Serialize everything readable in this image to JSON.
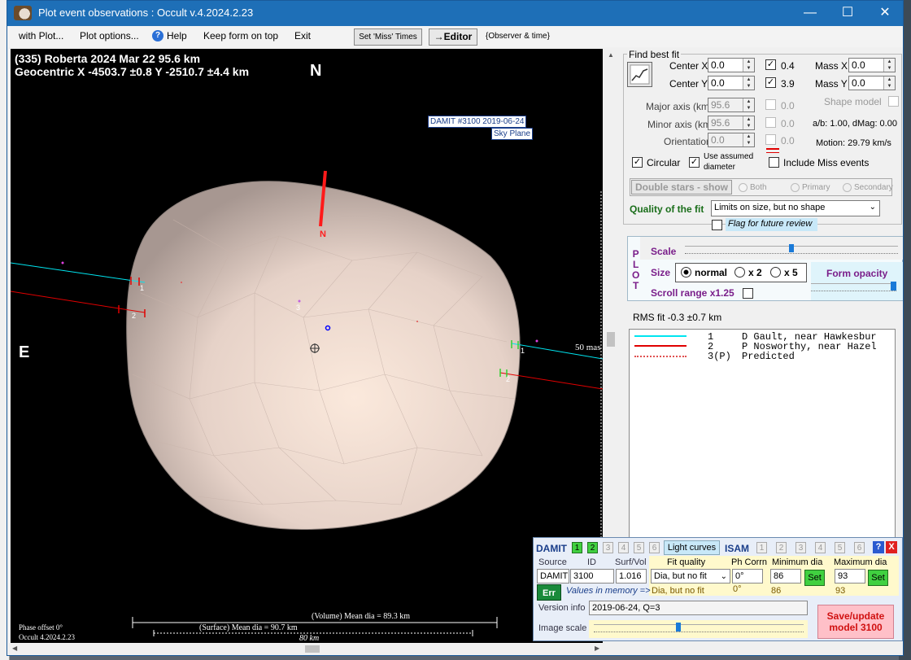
{
  "window": {
    "title": "Plot event observations : Occult v.4.2024.2.23",
    "minimize": "—",
    "maximize": "☐",
    "close": "✕"
  },
  "menu": {
    "with_plot": "with Plot...",
    "plot_options": "Plot options...",
    "help": "Help",
    "keep_on_top": "Keep form on top",
    "exit": "Exit",
    "set_miss": "Set 'Miss' Times",
    "editor": "→Editor",
    "observer_time": "{Observer & time}"
  },
  "plot": {
    "line1": "(335) Roberta  2024 Mar 22   95.6 km",
    "line2": "Geocentric  X  -4503.7 ±0.8  Y -2510.7 ±4.4 km",
    "north": "N",
    "east": "E",
    "north_marker": "N",
    "damit_label": "DAMIT #3100 2019-06-24",
    "sky_plane": "Sky Plane",
    "scale_mas": "50 mas",
    "chord_labels": [
      "1",
      "2",
      "1",
      "2",
      "3"
    ],
    "phase_offset": "Phase offset 0°",
    "version": "Occult 4.2024.2.23",
    "volume_dia": "(Volume) Mean dia = 89.3 km",
    "surface_dia": "(Surface) Mean dia = 90.7 km",
    "km_scale": "80 km"
  },
  "fit": {
    "title": "Find best fit",
    "center_x_label": "Center X",
    "center_x": "0.0",
    "center_y_label": "Center Y",
    "center_y": "0.0",
    "cb_04": "0.4",
    "cb_39": "3.9",
    "mass_x_label": "Mass X",
    "mass_x": "0.0",
    "mass_y_label": "Mass Y",
    "mass_y": "0.0",
    "major_label": "Major axis (km)",
    "major": "95.6",
    "major_cb": "0.0",
    "minor_label": "Minor axis (km)",
    "minor": "95.6",
    "minor_cb": "0.0",
    "orient_label": "Orientation",
    "orient": "0.0",
    "orient_cb": "0.0",
    "shape_model": "Shape model",
    "ab": "a/b: 1.00, dMag: 0.00",
    "motion": "Motion: 29.79 km/s",
    "circular": "Circular",
    "use_assumed": "Use assumed",
    "diameter": "diameter",
    "include_miss": "Include Miss events",
    "double_stars": "Double stars - show",
    "both": "Both",
    "primary": "Primary",
    "secondary": "Secondary",
    "quality_label": "Quality of the fit",
    "quality_value": "Limits on size, but no shape",
    "flag_review": "Flag for future review"
  },
  "plotpanel": {
    "p": "P",
    "l": "L",
    "o": "O",
    "t": "T",
    "scale": "Scale",
    "size": "Size",
    "normal": "normal",
    "x2": "x 2",
    "x5": "x 5",
    "form_opacity": "Form opacity",
    "scroll_range": "Scroll range x1.25",
    "scale_level": 0.5,
    "opacity_level": 1.0
  },
  "rms": "RMS fit -0.3 ±0.7 km",
  "legend": [
    {
      "num": "1",
      "text": "D Gault, near Hawkesbur",
      "color": "#00e5f0",
      "style": "solid"
    },
    {
      "num": "2",
      "text": "P Nosworthy, near Hazel",
      "color": "#e00000",
      "style": "solid"
    },
    {
      "num": "3(P)",
      "text": "Predicted",
      "color": "#e05050",
      "style": "dotted"
    }
  ],
  "damit": {
    "damit": "DAMIT",
    "d1": "1",
    "d2": "2",
    "d3": "3",
    "d4": "4",
    "d5": "5",
    "d6": "6",
    "light_curves": "Light curves",
    "isam": "ISAM",
    "i1": "1",
    "i2": "2",
    "i3": "3",
    "i4": "4",
    "i5": "5",
    "i6": "6",
    "help": "?",
    "close": "X",
    "source_h": "Source",
    "id_h": "ID",
    "surf_h": "Surf/Vol",
    "fitq_h": "Fit quality",
    "ph_h": "Ph Corrn",
    "min_h": "Minimum dia",
    "max_h": "Maximum dia",
    "source": "DAMIT",
    "id": "3100",
    "surf": "1.016",
    "fitq": "Dia, but no fit",
    "ph": "0°",
    "min": "86",
    "max": "93",
    "set": "Set",
    "err": "Err",
    "values_mem": "Values in memory =>",
    "mem_fitq": "Dia, but no fit",
    "mem_ph": "0°",
    "mem_min": "86",
    "mem_max": "93",
    "version_label": "Version info",
    "version": "2019-06-24, Q=3",
    "image_scale": "Image scale",
    "save": "Save/update",
    "save2": "model 3100",
    "image_scale_level": 0.4
  }
}
